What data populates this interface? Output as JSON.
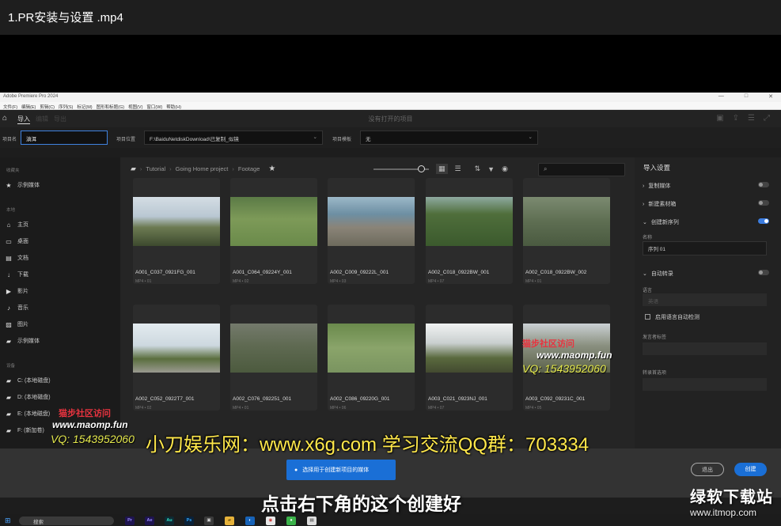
{
  "video_title": "1.PR安装与设置 .mp4",
  "window": {
    "app_title": "Adobe Premiere Pro 2024",
    "controls": [
      "—",
      "□",
      "✕"
    ]
  },
  "menu": [
    "文件(F)",
    "编辑(E)",
    "剪辑(C)",
    "序列(S)",
    "标记(M)",
    "图形和标题(G)",
    "视图(V)",
    "窗口(W)",
    "帮助(H)"
  ],
  "toolbar": {
    "tabs": [
      "导入",
      "编辑",
      "导出"
    ],
    "center_title": "没有打开的项目"
  },
  "fields": {
    "project_name_label": "项目名",
    "project_name_value": "滇洱",
    "location_label": "项目位置",
    "location_value": "F:\\BaiduNetdiskDownload\\已复制_似镜",
    "template_label": "项目模板",
    "template_value": "无"
  },
  "left": {
    "favorites_header": "收藏夹",
    "favorites": [
      "示例媒体"
    ],
    "local_header": "本地",
    "local_items": [
      "主页",
      "桌面",
      "文档",
      "下载",
      "影片",
      "音乐",
      "图片",
      "示例媒体"
    ],
    "devices_header": "设备",
    "devices": [
      "C: (本地磁盘)",
      "D: (本地磁盘)",
      "E: (本地磁盘)",
      "F: (新加卷)"
    ]
  },
  "center": {
    "breadcrumb": [
      "Tutorial",
      "Going Home project",
      "Footage"
    ],
    "search_placeholder": "",
    "zoom_level": 0.85,
    "clips": [
      {
        "name": "A001_C037_0921FG_001",
        "meta": "MP4 • 01",
        "scene": "hill-cross"
      },
      {
        "name": "A001_C064_09224Y_001",
        "meta": "MP4 • 02",
        "scene": "soccer"
      },
      {
        "name": "A002_C009_09222L_001",
        "meta": "MP4 • 03",
        "scene": "aerial-lake"
      },
      {
        "name": "A002_C018_0922BW_001",
        "meta": "MP4 • 07",
        "scene": "aerial-forest"
      },
      {
        "name": "A002_C018_0922BW_002",
        "meta": "MP4 • 01",
        "scene": "aerial-ruins"
      },
      {
        "name": "A002_C052_0922T7_001",
        "meta": "MP4 • 02",
        "scene": "tree-rock"
      },
      {
        "name": "A002_C076_092251_001",
        "meta": "MP4 • 01",
        "scene": "goal-field"
      },
      {
        "name": "A002_C086_09220G_001",
        "meta": "MP4 • 06",
        "scene": "ball-feet"
      },
      {
        "name": "A003_C021_0923NJ_001",
        "meta": "MP4 • 07",
        "scene": "ruins-tree"
      },
      {
        "name": "A003_C092_09231C_001",
        "meta": "MP4 • 05",
        "scene": "ruins-people"
      }
    ]
  },
  "right": {
    "header": "导入设置",
    "copy_media": "复制媒体",
    "new_bin": "新建素材箱",
    "create_sequence": "创建新序列",
    "name_label": "名称",
    "sequence_name": "序列 01",
    "auto_transcribe": "自动转录",
    "language_label": "语言",
    "language_value": "英语",
    "detect_label": "启用语言自动检测",
    "speaker_label": "发言者标签",
    "model_label": "转录首选项",
    "toggles": {
      "copy_media": false,
      "new_bin": false,
      "create_sequence": true,
      "auto_transcribe": false
    }
  },
  "bottom": {
    "select_media_button": "选择用于创建新项目的媒体",
    "exit_button": "退出",
    "create_button": "创建"
  },
  "taskbar": {
    "search": "搜索",
    "apps": [
      "Pr",
      "Ae",
      "Au",
      "Ps"
    ]
  },
  "overlays": {
    "site_banner": "小刀娱乐网：www.x6g.com 学习交流QQ群：703334",
    "subtitle": "点击右下角的这个创建好",
    "watermark_name": "猫步社区访问",
    "watermark_url": "www.maomp.fun",
    "watermark_qq": "VQ: 1543952060",
    "corner_logo": "绿软下载站",
    "corner_url": "www.itmop.com"
  },
  "colors": {
    "accent_blue": "#1a6fd6",
    "banner_yellow": "#ffe84a",
    "watermark_red": "#e8333f"
  }
}
